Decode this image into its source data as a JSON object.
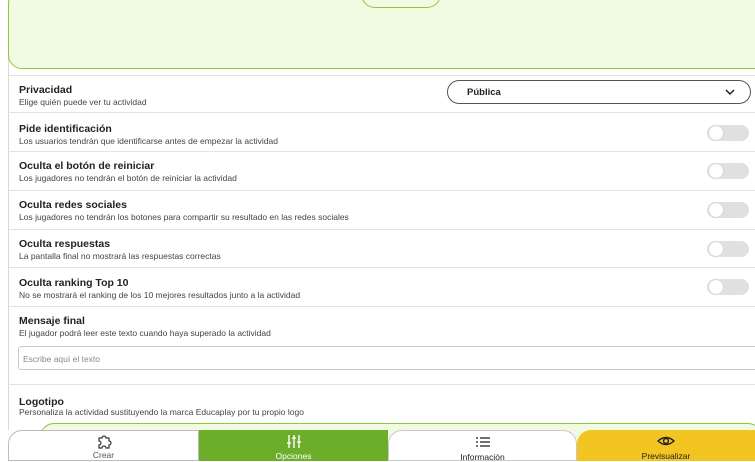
{
  "privacy": {
    "title": "Privacidad",
    "description": "Elige quién puede ver tu actividad",
    "selected": "Pública"
  },
  "settings": [
    {
      "title": "Pide identificación",
      "description": "Los usuarios tendrán que identificarse antes de empezar la actividad",
      "on": false
    },
    {
      "title": "Oculta el botón de reiniciar",
      "description": "Los jugadores no tendrán el botón de reiniciar la actividad",
      "on": false
    },
    {
      "title": "Oculta redes sociales",
      "description": "Los jugadores no tendrán los botones para compartir su resultado en las redes sociales",
      "on": false
    },
    {
      "title": "Oculta respuestas",
      "description": "La pantalla final no mostrará las respuestas correctas",
      "on": false
    },
    {
      "title": "Oculta ranking Top 10",
      "description": "No se mostrará el ranking de los 10 mejores resultados junto a la actividad",
      "on": false
    }
  ],
  "final_message": {
    "title": "Mensaje final",
    "description": "El jugador podrá leer este texto cuando haya superado la actividad",
    "placeholder": "Escribe aquí el texto"
  },
  "logo": {
    "title": "Logotipo",
    "description": "Personaliza la actividad sustituyendo la marca Educaplay por tu propio logo"
  },
  "tabs": [
    {
      "label": "Crear",
      "icon": "puzzle-icon"
    },
    {
      "label": "Opciones",
      "icon": "sliders-icon"
    },
    {
      "label": "Información",
      "icon": "list-icon"
    },
    {
      "label": "Previsualizar",
      "icon": "eye-icon"
    }
  ],
  "colors": {
    "accent_green": "#6cae2a",
    "panel_green": "#f1fbe2",
    "preview_yellow": "#f2c522",
    "toggle_off": "#e0e0e0"
  }
}
